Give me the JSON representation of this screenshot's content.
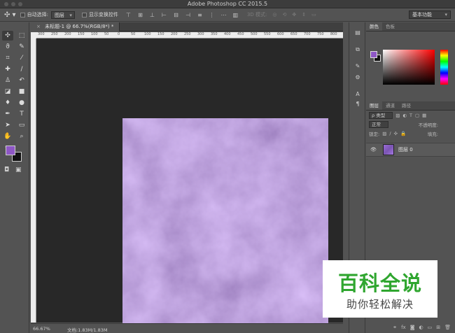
{
  "window": {
    "title": "Adobe Photoshop CC 2015.5"
  },
  "options": {
    "auto_select_label": "自动选择:",
    "auto_select_value": "图层",
    "show_transform_label": "显示变换控件",
    "mode_3d_label": "3D 模式:",
    "workspace": "基本功能"
  },
  "document": {
    "tab_title": "未标题-1 @ 66.7%(RGB/8*) *",
    "close_glyph": "×",
    "zoom": "66.67%",
    "doc_info": "文档:1.83M/1.83M"
  },
  "ruler_ticks": [
    "300",
    "250",
    "200",
    "150",
    "100",
    "50",
    "0",
    "50",
    "100",
    "150",
    "200",
    "250",
    "300",
    "350",
    "400",
    "450",
    "500",
    "550",
    "600",
    "650",
    "700",
    "750",
    "800"
  ],
  "color_panel": {
    "tabs": [
      "颜色",
      "色板"
    ],
    "foreground": "#8e57c5",
    "background": "#111111"
  },
  "layers_panel": {
    "tabs": [
      "图层",
      "通道",
      "路径"
    ],
    "filter_label": "ρ 类型",
    "blend_mode": "正常",
    "opacity_label": "不透明度:",
    "lock_label": "锁定:",
    "fill_label": "填充:",
    "layers": [
      {
        "name": "图层 0",
        "visible_glyph": "👁"
      }
    ]
  },
  "watermark": {
    "title": "百科全说",
    "subtitle": "助你轻松解决"
  },
  "colors": {
    "canvas_bg": "#282828",
    "ui_bg": "#535353",
    "accent_purple": "#8e57c5",
    "watermark_green": "#2fa62f"
  }
}
